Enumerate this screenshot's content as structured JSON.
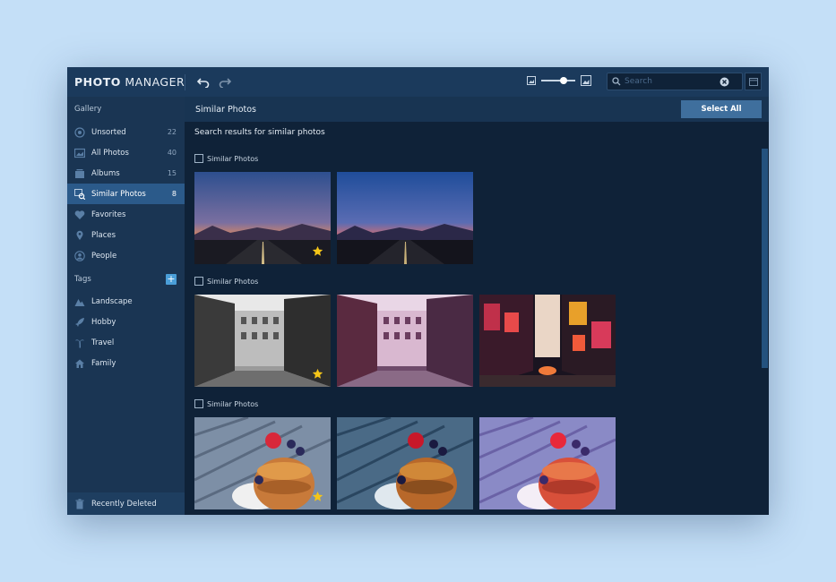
{
  "app": {
    "brand_bold": "PHOTO",
    "brand_light": " MANAGER"
  },
  "toolbar": {
    "undo_icon": "undo-icon",
    "redo_icon": "redo-icon",
    "zoom_level": 0.65,
    "search_placeholder": "Search"
  },
  "sidebar": {
    "gallery_heading": "Gallery",
    "items": [
      {
        "label": "Unsorted",
        "count": "22",
        "icon": "unsorted-icon"
      },
      {
        "label": "All Photos",
        "count": "40",
        "icon": "photos-icon"
      },
      {
        "label": "Albums",
        "count": "15",
        "icon": "albums-icon"
      },
      {
        "label": "Similar Photos",
        "count": "8",
        "icon": "similar-icon",
        "active": true
      },
      {
        "label": "Favorites",
        "count": "",
        "icon": "heart-icon"
      },
      {
        "label": "Places",
        "count": "",
        "icon": "pin-icon"
      },
      {
        "label": "People",
        "count": "",
        "icon": "person-icon"
      }
    ],
    "tags_heading": "Tags",
    "tags": [
      {
        "label": "Landscape",
        "icon": "mountain-icon"
      },
      {
        "label": "Hobby",
        "icon": "rocket-icon"
      },
      {
        "label": "Travel",
        "icon": "palm-icon"
      },
      {
        "label": "Family",
        "icon": "house-icon"
      }
    ],
    "recently_deleted": "Recently Deleted"
  },
  "main": {
    "title": "Similar Photos",
    "select_all": "Select All",
    "caption": "Search results for similar photos",
    "groups": [
      {
        "label": "Similar Photos",
        "photos": [
          "road-dusk-1",
          "road-dusk-2"
        ],
        "favorite_index": 0
      },
      {
        "label": "Similar Photos",
        "photos": [
          "street-bw",
          "street-purple",
          "times-square"
        ],
        "favorite_index": 0
      },
      {
        "label": "Similar Photos",
        "photos": [
          "pancakes-1",
          "pancakes-2",
          "pancakes-3"
        ],
        "favorite_index": 0
      }
    ]
  },
  "colors": {
    "accent": "#2b5a8a",
    "star": "#f5c518",
    "window_bg": "#0f2238"
  }
}
